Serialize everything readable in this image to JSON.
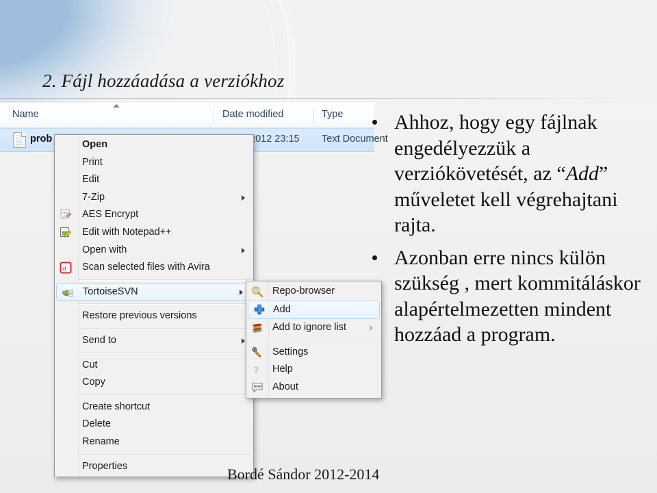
{
  "slide": {
    "title": "2. Fájl hozzáadása a verziókhoz",
    "footer": "Bordé Sándor 2012-2014",
    "accent_color": "#9fbedd",
    "background_color": "#f1f1f1"
  },
  "explorer": {
    "columns": {
      "name": "Name",
      "date_modified": "Date modified",
      "type": "Type"
    },
    "row": {
      "name": "prob",
      "date_modified": "2012 23:15",
      "type": "Text Document",
      "icon": "text-file-icon",
      "selected": true
    }
  },
  "context_menu": {
    "items": [
      {
        "label": "Open",
        "icon": "",
        "bold": true,
        "submenu": false,
        "separator_after": false
      },
      {
        "label": "Print",
        "icon": "",
        "bold": false,
        "submenu": false,
        "separator_after": false
      },
      {
        "label": "Edit",
        "icon": "",
        "bold": false,
        "submenu": false,
        "separator_after": false
      },
      {
        "label": "7-Zip",
        "icon": "",
        "bold": false,
        "submenu": true,
        "separator_after": false
      },
      {
        "label": "AES Encrypt",
        "icon": "aes-encrypt-icon",
        "bold": false,
        "submenu": false,
        "separator_after": false
      },
      {
        "label": "Edit with Notepad++",
        "icon": "notepadpp-icon",
        "bold": false,
        "submenu": false,
        "separator_after": false
      },
      {
        "label": "Open with",
        "icon": "",
        "bold": false,
        "submenu": true,
        "separator_after": false
      },
      {
        "label": "Scan selected files with Avira",
        "icon": "avira-icon",
        "bold": false,
        "submenu": false,
        "separator_after": true
      },
      {
        "label": "TortoiseSVN",
        "icon": "tortoisesvn-icon",
        "bold": false,
        "submenu": true,
        "selected": true,
        "separator_after": true
      },
      {
        "label": "Restore previous versions",
        "icon": "",
        "bold": false,
        "submenu": false,
        "separator_after": true
      },
      {
        "label": "Send to",
        "icon": "",
        "bold": false,
        "submenu": true,
        "separator_after": true
      },
      {
        "label": "Cut",
        "icon": "",
        "bold": false,
        "submenu": false,
        "separator_after": false
      },
      {
        "label": "Copy",
        "icon": "",
        "bold": false,
        "submenu": false,
        "separator_after": true
      },
      {
        "label": "Create shortcut",
        "icon": "",
        "bold": false,
        "submenu": false,
        "separator_after": false
      },
      {
        "label": "Delete",
        "icon": "",
        "bold": false,
        "submenu": false,
        "separator_after": false
      },
      {
        "label": "Rename",
        "icon": "",
        "bold": false,
        "submenu": false,
        "separator_after": true
      },
      {
        "label": "Properties",
        "icon": "",
        "bold": false,
        "submenu": false,
        "separator_after": false
      }
    ]
  },
  "submenu": {
    "items": [
      {
        "label": "Repo-browser",
        "icon": "repo-browser-icon",
        "submenu": false,
        "selected": false,
        "separator_after": false
      },
      {
        "label": "Add",
        "icon": "add-plus-icon",
        "submenu": false,
        "selected": true,
        "separator_after": false
      },
      {
        "label": "Add to ignore list",
        "icon": "ignore-list-icon",
        "submenu": true,
        "selected": false,
        "separator_after": true
      },
      {
        "label": "Settings",
        "icon": "settings-wrench-icon",
        "submenu": false,
        "selected": false,
        "separator_after": false
      },
      {
        "label": "Help",
        "icon": "help-question-icon",
        "submenu": false,
        "selected": false,
        "separator_after": false
      },
      {
        "label": "About",
        "icon": "about-info-icon",
        "submenu": false,
        "selected": false,
        "separator_after": false
      }
    ]
  },
  "body": {
    "bullets": [
      {
        "part1": "Ahhoz, hogy egy fájlnak engedélyezzük a verziókövetését, az “",
        "emphasis": "Add",
        "part2": "” műveletet kell végrehajtani rajta."
      },
      {
        "part1": "Azonban erre nincs külön szükség , mert kommitáláskor alapértelmezetten mindent hozzáad a program.",
        "emphasis": "",
        "part2": ""
      }
    ]
  }
}
